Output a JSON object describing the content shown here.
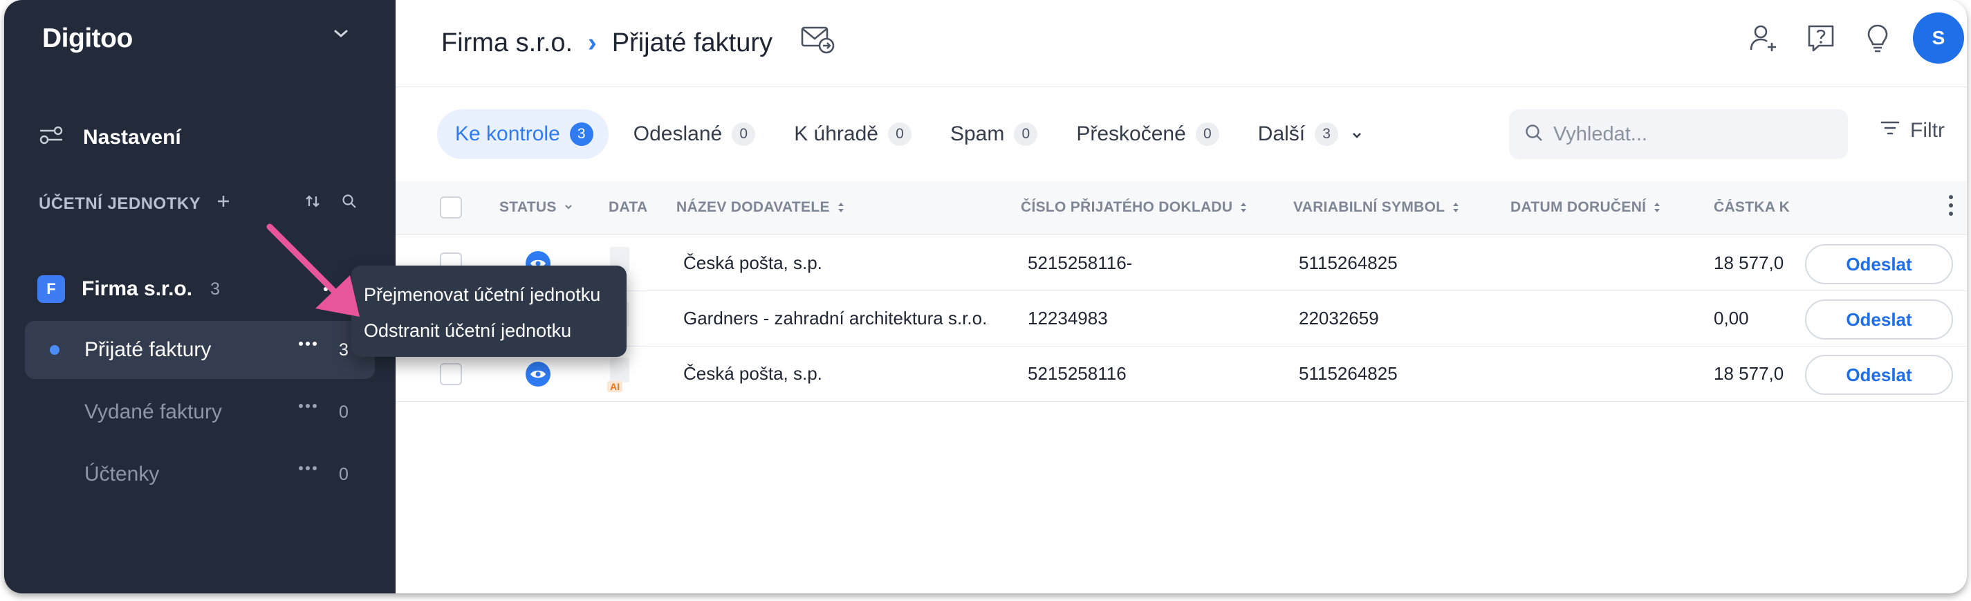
{
  "sidebar": {
    "brand": "Digitoo",
    "settings_label": "Nastavení",
    "section_title": "ÚČETNÍ JEDNOTKY",
    "company": {
      "badge": "F",
      "name": "Firma s.r.o.",
      "count": "3"
    },
    "items": [
      {
        "label": "Přijaté faktury",
        "count": "3",
        "active": true
      },
      {
        "label": "Vydané faktury",
        "count": "0",
        "active": false
      },
      {
        "label": "Účtenky",
        "count": "0",
        "active": false
      }
    ]
  },
  "context_menu": {
    "items": [
      {
        "label": "Přejmenovat účetní jednotku"
      },
      {
        "label": "Odstranit účetní jednotku"
      }
    ]
  },
  "header": {
    "breadcrumb": {
      "company": "Firma s.r.o.",
      "separator": "›",
      "page": "Přijaté faktury"
    },
    "avatar_initial": "S",
    "icons": [
      "mail-forward-icon",
      "add-user-icon",
      "help-icon",
      "lightbulb-icon"
    ]
  },
  "tabs": [
    {
      "label": "Ke kontrole",
      "count": "3",
      "active": true
    },
    {
      "label": "Odeslané",
      "count": "0"
    },
    {
      "label": "K úhradě",
      "count": "0"
    },
    {
      "label": "Spam",
      "count": "0"
    },
    {
      "label": "Přeskočené",
      "count": "0"
    },
    {
      "label": "Další",
      "count": "3"
    }
  ],
  "search": {
    "placeholder": "Vyhledat..."
  },
  "filter_label": "Filtr",
  "table": {
    "columns": [
      "STATUS",
      "DATA",
      "NÁZEV DODAVATELE",
      "ČÍSLO PŘIJATÉHO DOKLADU",
      "VARIABILNÍ SYMBOL",
      "DATUM DORUČENÍ",
      "ČÁSTKA K"
    ],
    "rows": [
      {
        "supplier": "Česká pošta, s.p.",
        "doc_number": "5215258116-",
        "var_symbol": "5115264825",
        "delivery_date": "",
        "amount": "18 577,0",
        "action": "Odeslat",
        "ai": ""
      },
      {
        "supplier": "Gardners - zahradní architektura s.r.o.",
        "doc_number": "12234983",
        "var_symbol": "22032659",
        "delivery_date": "",
        "amount": "0,00",
        "action": "Odeslat",
        "ai": ""
      },
      {
        "supplier": "Česká pošta, s.p.",
        "doc_number": "5215258116",
        "var_symbol": "5115264825",
        "delivery_date": "",
        "amount": "18 577,0",
        "action": "Odeslat",
        "ai": "AI"
      }
    ]
  },
  "colors": {
    "sidebar_bg": "#232b3b",
    "accent": "#2f7bf2",
    "annotation_arrow": "#e9559a"
  }
}
